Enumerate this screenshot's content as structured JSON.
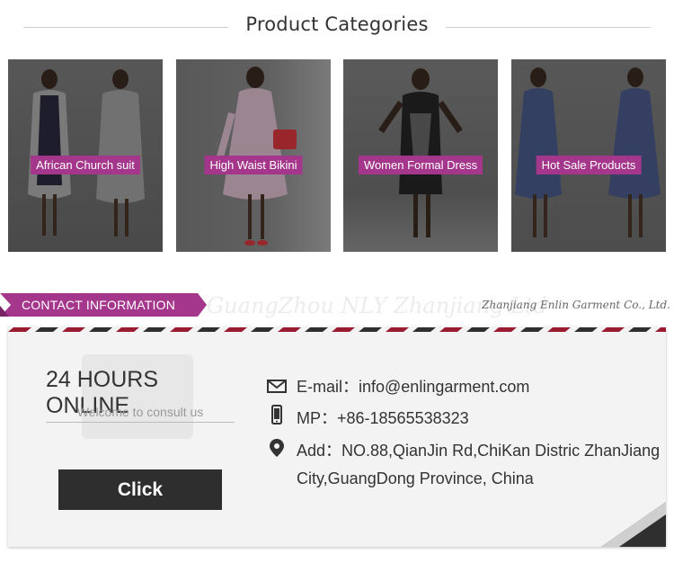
{
  "header": {
    "title": "Product Categories"
  },
  "categories": [
    {
      "label": "African Church suit"
    },
    {
      "label": "High Waist Bikini"
    },
    {
      "label": "Women Formal Dress"
    },
    {
      "label": "Hot Sale Products"
    }
  ],
  "contact_band": {
    "tag": "CONTACT INFORMATION",
    "company": "Zhanjiang Enlin Garment Co., Ltd.",
    "ghost_text": "GuangZhou NLY Zhanjiang Ltd"
  },
  "card": {
    "online_title": "24 HOURS ONLINE",
    "welcome": "Welcome to consult us",
    "click_label": "Click",
    "email_label": "E-mail：info@enlingarment.com",
    "phone_label": "MP：+86-18565538323",
    "address_line1": "Add：NO.88,QianJin Rd,ChiKan Distric ZhanJiang",
    "address_line2": "City,GuangDong Province, China"
  },
  "colors": {
    "accent": "#a4378c",
    "dark": "#2e2e2e",
    "stripe_red": "#9b1b30"
  },
  "icons": [
    "envelope-icon",
    "mobile-phone-icon",
    "location-pin-icon"
  ]
}
